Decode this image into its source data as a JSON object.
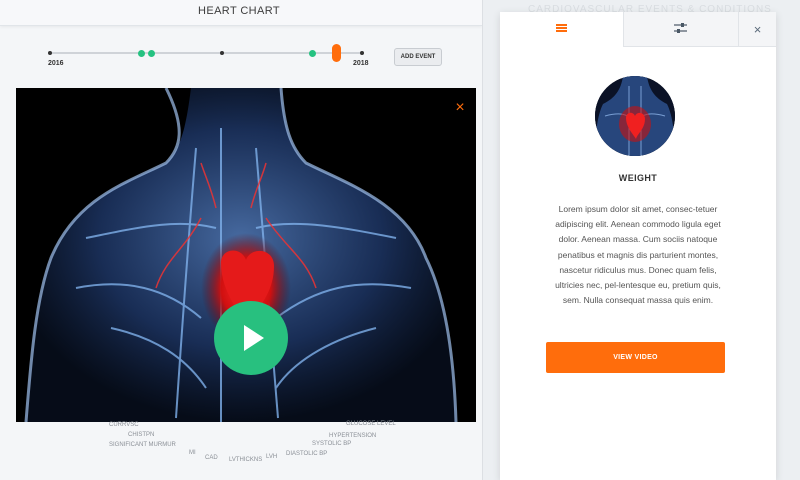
{
  "header": {
    "title": "HEART CHART"
  },
  "timeline": {
    "start_year": "2016",
    "end_year": "2018",
    "add_event_label": "ADD EVENT"
  },
  "video": {
    "close_icon": "×"
  },
  "conditions": {
    "left": [
      "CURRVSC",
      "CHISTPN",
      "SIGNIFICANT MURMUR",
      "MI",
      "CAD",
      "LVTHICKNS",
      "LVH"
    ],
    "right": [
      "GLUCOSE LEVEL",
      "HYPERTENSION",
      "SYSTOLIC BP",
      "DIASTOLIC BP"
    ]
  },
  "background_heading": "CARDIOVASCULAR EVENTS & CONDITIONS",
  "panel": {
    "close_icon": "×",
    "title": "WEIGHT",
    "description": "Lorem ipsum dolor sit amet, consec-tetuer adipiscing elit. Aenean commodo ligula eget dolor. Aenean massa. Cum sociis natoque penatibus et magnis dis parturient montes, nascetur ridiculus mus. Donec quam felis, ultricies nec, pel-lentesque eu, pretium quis, sem. Nulla consequat massa quis enim.",
    "button_label": "VIEW VIDEO"
  },
  "colors": {
    "accent": "#ff6d0c",
    "green": "#28c07f"
  }
}
